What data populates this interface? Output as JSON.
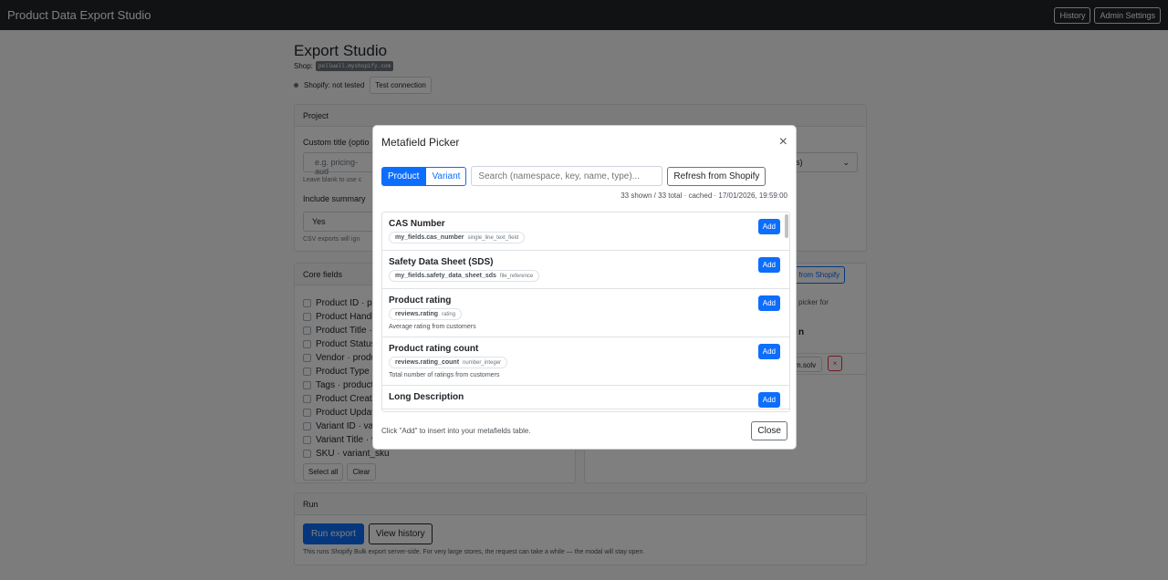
{
  "app": {
    "title": "Product Data Export Studio",
    "history_label": "History",
    "admin_label": "Admin Settings"
  },
  "page": {
    "title": "Export Studio",
    "shop_label": "Shop:",
    "shop_domain": "pellwall.myshopify.com",
    "status_text": "Shopify: not tested",
    "test_connection_label": "Test connection"
  },
  "project": {
    "header": "Project",
    "custom_title_label": "Custom title (optio",
    "custom_title_placeholder": "e.g. pricing-aud",
    "custom_title_help": "Leave blank to use c",
    "include_summary_label": "Include summary",
    "include_summary_value": "Yes",
    "csv_note": "CSV exports will ign",
    "right_select_value": "s)"
  },
  "core_fields": {
    "header": "Core fields",
    "items": [
      "Product ID · pr",
      "Product Handl",
      "Product Title ·",
      "Product Status",
      "Vendor · produ",
      "Product Type ·",
      "Tags · product",
      "Product Create",
      "Product Updat",
      "Variant ID · var",
      "Variant Title · v",
      "SKU · variant_sku"
    ],
    "select_all_label": "Select all",
    "clear_label": "Clear"
  },
  "metafields_card": {
    "pick_button_label": "ck from Shopify",
    "help_text": "picker for",
    "heading": "n",
    "row_value": "m.solv",
    "remove_label": "×"
  },
  "run": {
    "header": "Run",
    "run_export_label": "Run export",
    "view_history_label": "View history",
    "note": "This runs Shopify Bulk export server-side. For very large stores, the request can take a while — the modal will stay open."
  },
  "modal": {
    "title": "Metafield Picker",
    "close_icon": "×",
    "tabs": [
      "Product",
      "Variant"
    ],
    "search_placeholder": "Search (namespace, key, name, type)...",
    "refresh_label": "Refresh from Shopify",
    "count_text": "33 shown / 33 total · cached · 17/01/2026, 19:59:00",
    "add_label": "Add",
    "items": [
      {
        "name": "CAS Number",
        "key": "my_fields.cas_number",
        "type": "single_line_text_field",
        "desc": ""
      },
      {
        "name": "Safety Data Sheet (SDS)",
        "key": "my_fields.safety_data_sheet_sds",
        "type": "file_reference",
        "desc": ""
      },
      {
        "name": "Product rating",
        "key": "reviews.rating",
        "type": "rating",
        "desc": "Average rating from customers"
      },
      {
        "name": "Product rating count",
        "key": "reviews.rating_count",
        "type": "number_integer",
        "desc": "Total number of ratings from customers"
      },
      {
        "name": "Long Description",
        "key": "",
        "type": "",
        "desc": ""
      }
    ],
    "footer_note": "Click \"Add\" to insert into your metafields table.",
    "close_label": "Close"
  },
  "colors": {
    "primary": "#0d6efd",
    "topbar": "#212529",
    "overlay": "rgba(0,0,0,0.5)"
  }
}
